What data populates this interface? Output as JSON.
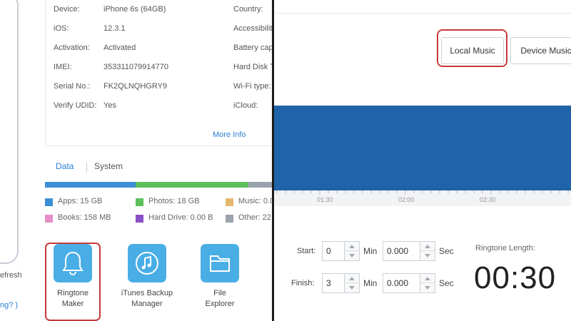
{
  "left_panel": {
    "refresh_text": "efresh",
    "help_text": "ng? )",
    "device_info": [
      {
        "key": "Device:",
        "value": "iPhone 6s   (64GB)",
        "key2": "Country:"
      },
      {
        "key": "iOS:",
        "value": "12.3.1",
        "key2": "Accessibilit"
      },
      {
        "key": "Activation:",
        "value": "Activated",
        "key2": "Battery cap"
      },
      {
        "key": "IMEI:",
        "value": "353311079914770",
        "key2": "Hard Disk T"
      },
      {
        "key": "Serial No.:",
        "value": "FK2QLNQHGRY9",
        "key2": "Wi-Fi type:"
      },
      {
        "key": "Verify UDID:",
        "value": "Yes",
        "key2": "iCloud:"
      }
    ],
    "more_info": "More Info",
    "tabs": {
      "data": "Data",
      "system": "System"
    },
    "storage": [
      {
        "label": "Apps: 15 GB",
        "color": "#3d8fd6"
      },
      {
        "label": "Photos: 18 GB",
        "color": "#5cbf5c"
      },
      {
        "label": "Music: 0.0",
        "color": "#e2b96a"
      },
      {
        "label": "Books: 158 MB",
        "color": "#e58fc7"
      },
      {
        "label": "Hard Drive: 0.00 B",
        "color": "#8a4fc9"
      },
      {
        "label": "Other: 22",
        "color": "#9aa3ad"
      }
    ],
    "tools": [
      {
        "label_line1": "Ringtone",
        "label_line2": "Maker",
        "icon": "bell-icon"
      },
      {
        "label_line1": "iTunes Backup",
        "label_line2": "Manager",
        "icon": "music-note-icon"
      },
      {
        "label_line1": "File",
        "label_line2": "Explorer",
        "icon": "folder-icon"
      }
    ]
  },
  "right_panel": {
    "local_music": "Local Music",
    "device_music": "Device Music",
    "timeline_ticks": [
      "01:30",
      "02:00",
      "02:30"
    ],
    "start": {
      "label": "Start:",
      "min": "0",
      "min_unit": "Min",
      "sec": "0.000",
      "sec_unit": "Sec"
    },
    "finish": {
      "label": "Finish:",
      "min": "3",
      "min_unit": "Min",
      "sec": "0.000",
      "sec_unit": "Sec"
    },
    "ringtone_length_label": "Ringtone Length:",
    "ringtone_length_value": "00:30",
    "waveform_color": "#1f64a8",
    "highlight_color": "#c73a3a"
  }
}
